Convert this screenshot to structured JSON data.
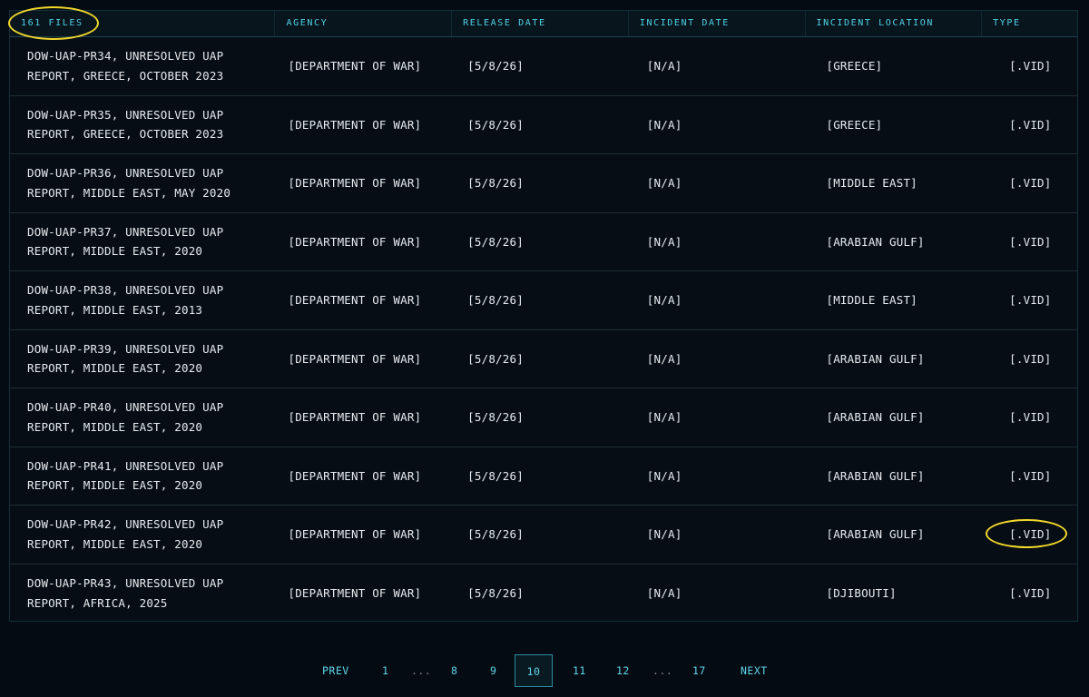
{
  "header": {
    "files_count": "161 FILES",
    "agency": "AGENCY",
    "release_date": "RELEASE DATE",
    "incident_date": "INCIDENT DATE",
    "incident_location": "INCIDENT LOCATION",
    "type": "TYPE"
  },
  "rows": [
    {
      "title_line1": "DOW-UAP-PR34, UNRESOLVED UAP",
      "title_line2": "REPORT, GREECE, OCTOBER 2023",
      "agency": "[DEPARTMENT OF WAR]",
      "release_date": "[5/8/26]",
      "incident_date": "[N/A]",
      "location": "[GREECE]",
      "type": "[.VID]"
    },
    {
      "title_line1": "DOW-UAP-PR35, UNRESOLVED UAP",
      "title_line2": "REPORT, GREECE, OCTOBER 2023",
      "agency": "[DEPARTMENT OF WAR]",
      "release_date": "[5/8/26]",
      "incident_date": "[N/A]",
      "location": "[GREECE]",
      "type": "[.VID]"
    },
    {
      "title_line1": "DOW-UAP-PR36, UNRESOLVED UAP",
      "title_line2": "REPORT, MIDDLE EAST, MAY 2020",
      "agency": "[DEPARTMENT OF WAR]",
      "release_date": "[5/8/26]",
      "incident_date": "[N/A]",
      "location": "[MIDDLE EAST]",
      "type": "[.VID]"
    },
    {
      "title_line1": "DOW-UAP-PR37, UNRESOLVED UAP",
      "title_line2": "REPORT, MIDDLE EAST, 2020",
      "agency": "[DEPARTMENT OF WAR]",
      "release_date": "[5/8/26]",
      "incident_date": "[N/A]",
      "location": "[ARABIAN GULF]",
      "type": "[.VID]"
    },
    {
      "title_line1": "DOW-UAP-PR38, UNRESOLVED UAP",
      "title_line2": "REPORT, MIDDLE EAST, 2013",
      "agency": "[DEPARTMENT OF WAR]",
      "release_date": "[5/8/26]",
      "incident_date": "[N/A]",
      "location": "[MIDDLE EAST]",
      "type": "[.VID]"
    },
    {
      "title_line1": "DOW-UAP-PR39, UNRESOLVED UAP",
      "title_line2": "REPORT, MIDDLE EAST, 2020",
      "agency": "[DEPARTMENT OF WAR]",
      "release_date": "[5/8/26]",
      "incident_date": "[N/A]",
      "location": "[ARABIAN GULF]",
      "type": "[.VID]"
    },
    {
      "title_line1": "DOW-UAP-PR40, UNRESOLVED UAP",
      "title_line2": "REPORT, MIDDLE EAST, 2020",
      "agency": "[DEPARTMENT OF WAR]",
      "release_date": "[5/8/26]",
      "incident_date": "[N/A]",
      "location": "[ARABIAN GULF]",
      "type": "[.VID]"
    },
    {
      "title_line1": "DOW-UAP-PR41, UNRESOLVED UAP",
      "title_line2": "REPORT, MIDDLE EAST, 2020",
      "agency": "[DEPARTMENT OF WAR]",
      "release_date": "[5/8/26]",
      "incident_date": "[N/A]",
      "location": "[ARABIAN GULF]",
      "type": "[.VID]"
    },
    {
      "title_line1": "DOW-UAP-PR42, UNRESOLVED UAP",
      "title_line2": "REPORT, MIDDLE EAST, 2020",
      "agency": "[DEPARTMENT OF WAR]",
      "release_date": "[5/8/26]",
      "incident_date": "[N/A]",
      "location": "[ARABIAN GULF]",
      "type": "[.VID]"
    },
    {
      "title_line1": "DOW-UAP-PR43, UNRESOLVED UAP",
      "title_line2": "REPORT, AFRICA, 2025",
      "agency": "[DEPARTMENT OF WAR]",
      "release_date": "[5/8/26]",
      "incident_date": "[N/A]",
      "location": "[DJIBOUTI]",
      "type": "[.VID]"
    }
  ],
  "pagination": {
    "prev": "PREV",
    "p1": "1",
    "ellipsis1": "...",
    "p8": "8",
    "p9": "9",
    "current": "10",
    "p11": "11",
    "p12": "12",
    "ellipsis2": "...",
    "p17": "17",
    "next": "NEXT"
  },
  "colors": {
    "background": "#050b12",
    "header_text": "#4fd3e6",
    "annotation": "#f2d92a"
  }
}
